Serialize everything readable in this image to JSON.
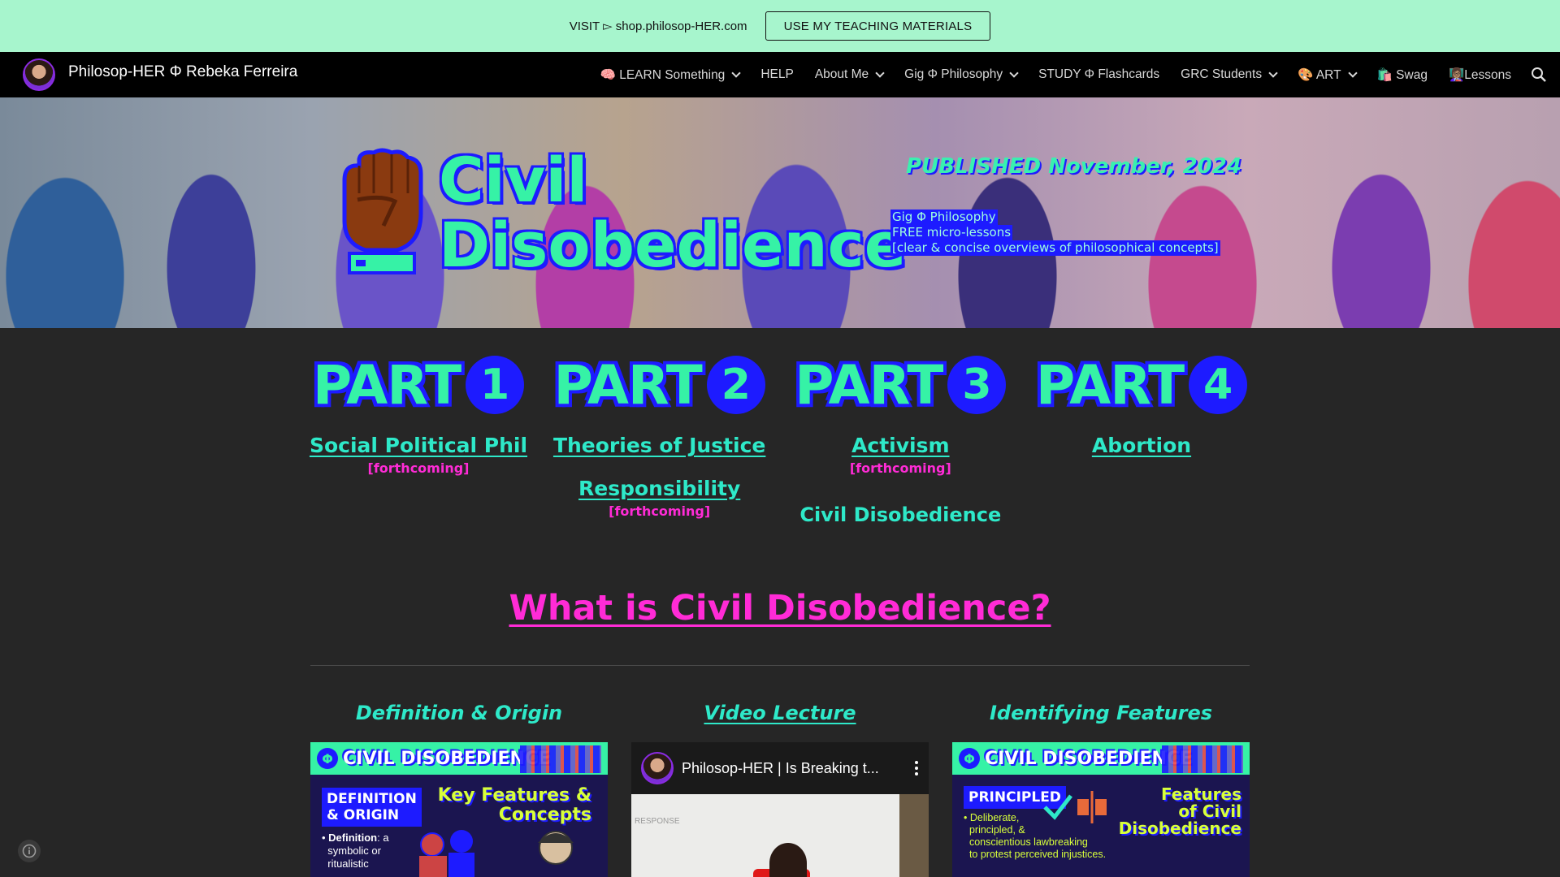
{
  "promo": {
    "text": "VISIT ▻ shop.philosop-HER.com",
    "button": "USE MY TEACHING MATERIALS"
  },
  "nav": {
    "site_title": "Philosop-HER Φ Rebeka Ferreira",
    "items": [
      {
        "label": "🧠 LEARN Something",
        "dropdown": true
      },
      {
        "label": "HELP",
        "dropdown": false
      },
      {
        "label": "About Me",
        "dropdown": true
      },
      {
        "label": "Gig Φ Philosophy",
        "dropdown": true
      },
      {
        "label": "STUDY Φ Flashcards",
        "dropdown": false
      },
      {
        "label": "GRC Students",
        "dropdown": true
      },
      {
        "label": "🎨 ART",
        "dropdown": true
      },
      {
        "label": "🛍️ Swag",
        "dropdown": false
      },
      {
        "label": "👩🏽‍🏫Lessons",
        "dropdown": false
      }
    ],
    "search_icon": "search-icon"
  },
  "hero": {
    "title_line1": "Civil",
    "title_line2": "Disobedience",
    "published": "PUBLISHED November, 2024",
    "caption": [
      "Gig Φ Philosophy",
      "FREE micro-lessons",
      "[clear & concise overviews of philosophical concepts]"
    ],
    "icon": "raised-fist-icon"
  },
  "parts": [
    {
      "word": "PART",
      "num": "1",
      "links": [
        {
          "label": "Social Political Phil",
          "sub": "[forthcoming]"
        }
      ]
    },
    {
      "word": "PART",
      "num": "2",
      "links": [
        {
          "label": "Theories of Justice",
          "sub": ""
        },
        {
          "label": "Responsibility",
          "sub": "[forthcoming]"
        }
      ]
    },
    {
      "word": "PART",
      "num": "3",
      "links": [
        {
          "label": "Activism",
          "sub": "[forthcoming]"
        }
      ],
      "current": "Civil Disobedience"
    },
    {
      "word": "PART",
      "num": "4",
      "links": [
        {
          "label": "Abortion",
          "sub": ""
        }
      ]
    }
  ],
  "section_title": "What is Civil Disobedience?",
  "columns": {
    "col1": {
      "title": "Definition & Origin",
      "card_head": "CIVIL DISOBEDIENCE",
      "tag_line1": "DEFINITION",
      "tag_line2": "& ORIGIN",
      "feature_line1": "Key Features &",
      "feature_line2": "Concepts",
      "bullet_label": "Definition",
      "bullet_text_1": ": a",
      "bullet_text_2": "symbolic or",
      "bullet_text_3": "ritualistic"
    },
    "col2": {
      "title": "Video Lecture",
      "video_title": "Philosop-HER | Is Breaking t...",
      "whiteboard_text": "RESPONSE"
    },
    "col3": {
      "title": "Identifying Features",
      "card_head": "CIVIL DISOBEDIENCE",
      "tag": "PRINCIPLED",
      "feature_line1": "Features",
      "feature_line2": "of Civil",
      "feature_line3": "Disobedience",
      "bullet_line1": "Deliberate,",
      "bullet_line2": "principled,  &",
      "bullet_line3": "conscientious lawbreaking",
      "bullet_line4": "to protest perceived injustices."
    }
  },
  "colors": {
    "promo_bg": "#a7f5cd",
    "accent_green": "#36f2a6",
    "accent_blue": "#1d1bff",
    "accent_pink": "#ff2bd6",
    "link_teal": "#2ee9c9",
    "page_bg": "#262626"
  }
}
